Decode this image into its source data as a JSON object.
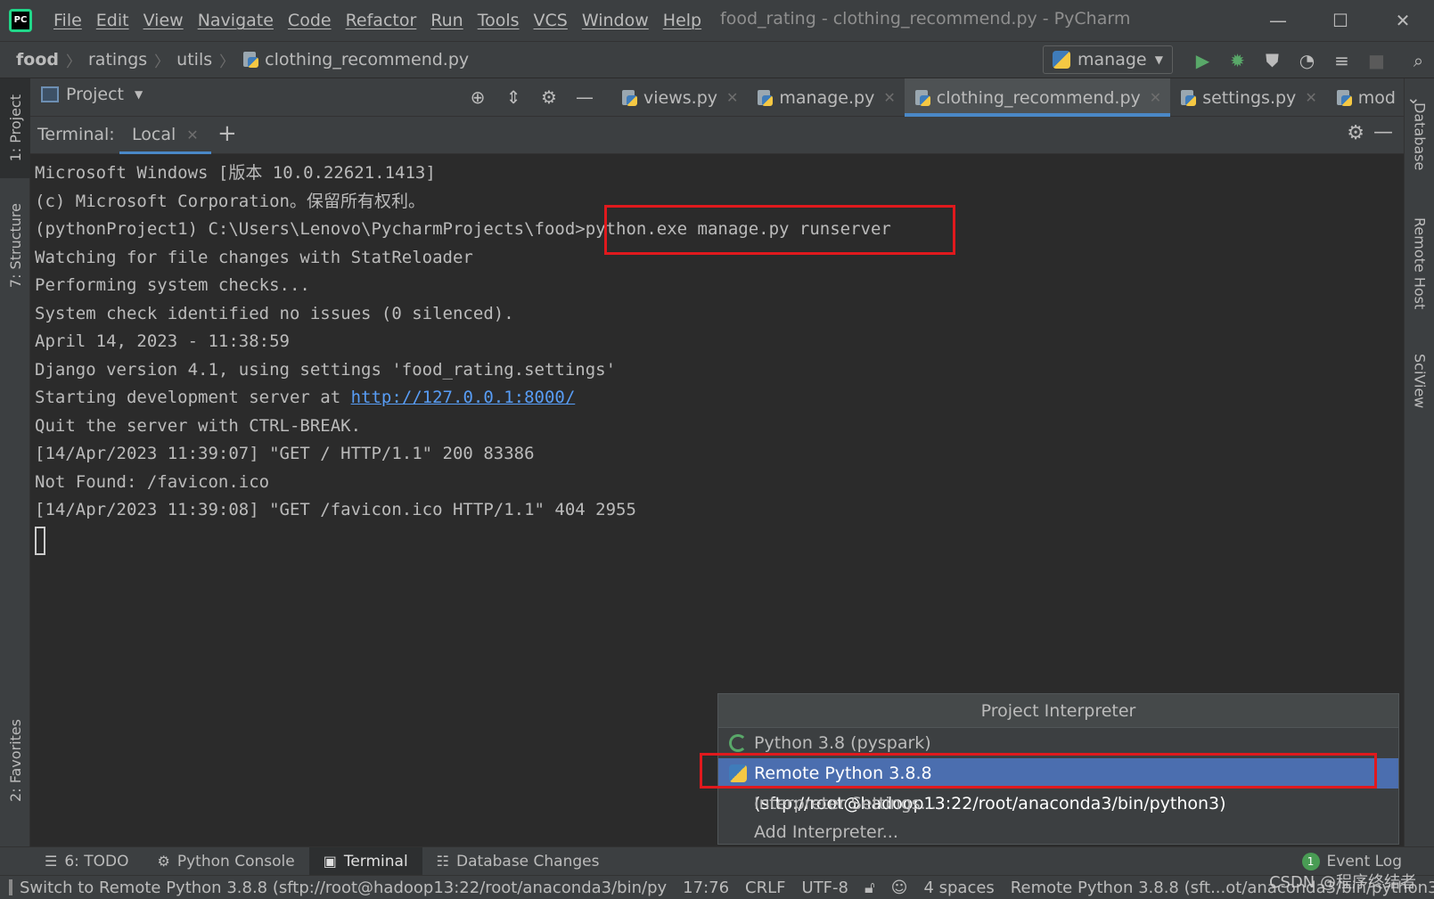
{
  "menu": [
    "File",
    "Edit",
    "View",
    "Navigate",
    "Code",
    "Refactor",
    "Run",
    "Tools",
    "VCS",
    "Window",
    "Help"
  ],
  "window_title": "food_rating - clothing_recommend.py - PyCharm",
  "breadcrumbs": [
    "food",
    "ratings",
    "utils",
    "clothing_recommend.py"
  ],
  "run_config": "manage",
  "project_panel_title": "Project",
  "tabs": [
    {
      "label": "views.py",
      "active": false
    },
    {
      "label": "manage.py",
      "active": false
    },
    {
      "label": "clothing_recommend.py",
      "active": true
    },
    {
      "label": "settings.py",
      "active": false
    },
    {
      "label": "mod",
      "active": false
    }
  ],
  "left_tools": [
    "1: Project",
    "7: Structure",
    "2: Favorites"
  ],
  "right_tools": [
    "Database",
    "Remote Host",
    "SciView"
  ],
  "terminal": {
    "label": "Terminal:",
    "tab": "Local",
    "lines": [
      "Microsoft Windows [版本 10.0.22621.1413]",
      "(c) Microsoft Corporation。保留所有权利。",
      "(pythonProject1) C:\\Users\\Lenovo\\PycharmProjects\\food>python.exe manage.py runserver",
      "Watching for file changes with StatReloader",
      "Performing system checks...",
      "System check identified no issues (0 silenced).",
      "April 14, 2023 - 11:38:59",
      "Django version 4.1, using settings 'food_rating.settings'",
      "Starting development server at ",
      "Quit the server with CTRL-BREAK.",
      "[14/Apr/2023 11:39:07] \"GET / HTTP/1.1\" 200 83386",
      "Not Found: /favicon.ico",
      "[14/Apr/2023 11:39:08] \"GET /favicon.ico HTTP/1.1\" 404 2955"
    ],
    "server_url": "http://127.0.0.1:8000/"
  },
  "popup": {
    "title": "Project Interpreter",
    "items": [
      "Python 3.8 (pyspark)",
      "Remote Python 3.8.8 (sftp://root@hadoop13:22/root/anaconda3/bin/python3)",
      "Interpreter Settings...",
      "Add Interpreter..."
    ]
  },
  "bottom_tabs": [
    {
      "label": "6: TODO",
      "icon": "list-icon",
      "active": false
    },
    {
      "label": "Python Console",
      "icon": "python-icon",
      "active": false
    },
    {
      "label": "Terminal",
      "icon": "terminal-icon",
      "active": true
    },
    {
      "label": "Database Changes",
      "icon": "database-icon",
      "active": false
    }
  ],
  "event_log": {
    "count": "1",
    "label": "Event Log"
  },
  "status": {
    "message": "Switch to Remote Python 3.8.8 (sftp://root@hadoop13:22/root/anaconda3/bin/py",
    "position": "17:76",
    "line_sep": "CRLF",
    "encoding": "UTF-8",
    "indent": "4 spaces",
    "interpreter": "Remote Python 3.8.8 (sft...ot/anaconda3/bin/python3)"
  },
  "watermark": "CSDN @程序终结者",
  "colors": {
    "accent": "#4a88c7",
    "selection": "#4b6eaf",
    "annotation_red": "#e0191d",
    "link": "#589df6"
  }
}
